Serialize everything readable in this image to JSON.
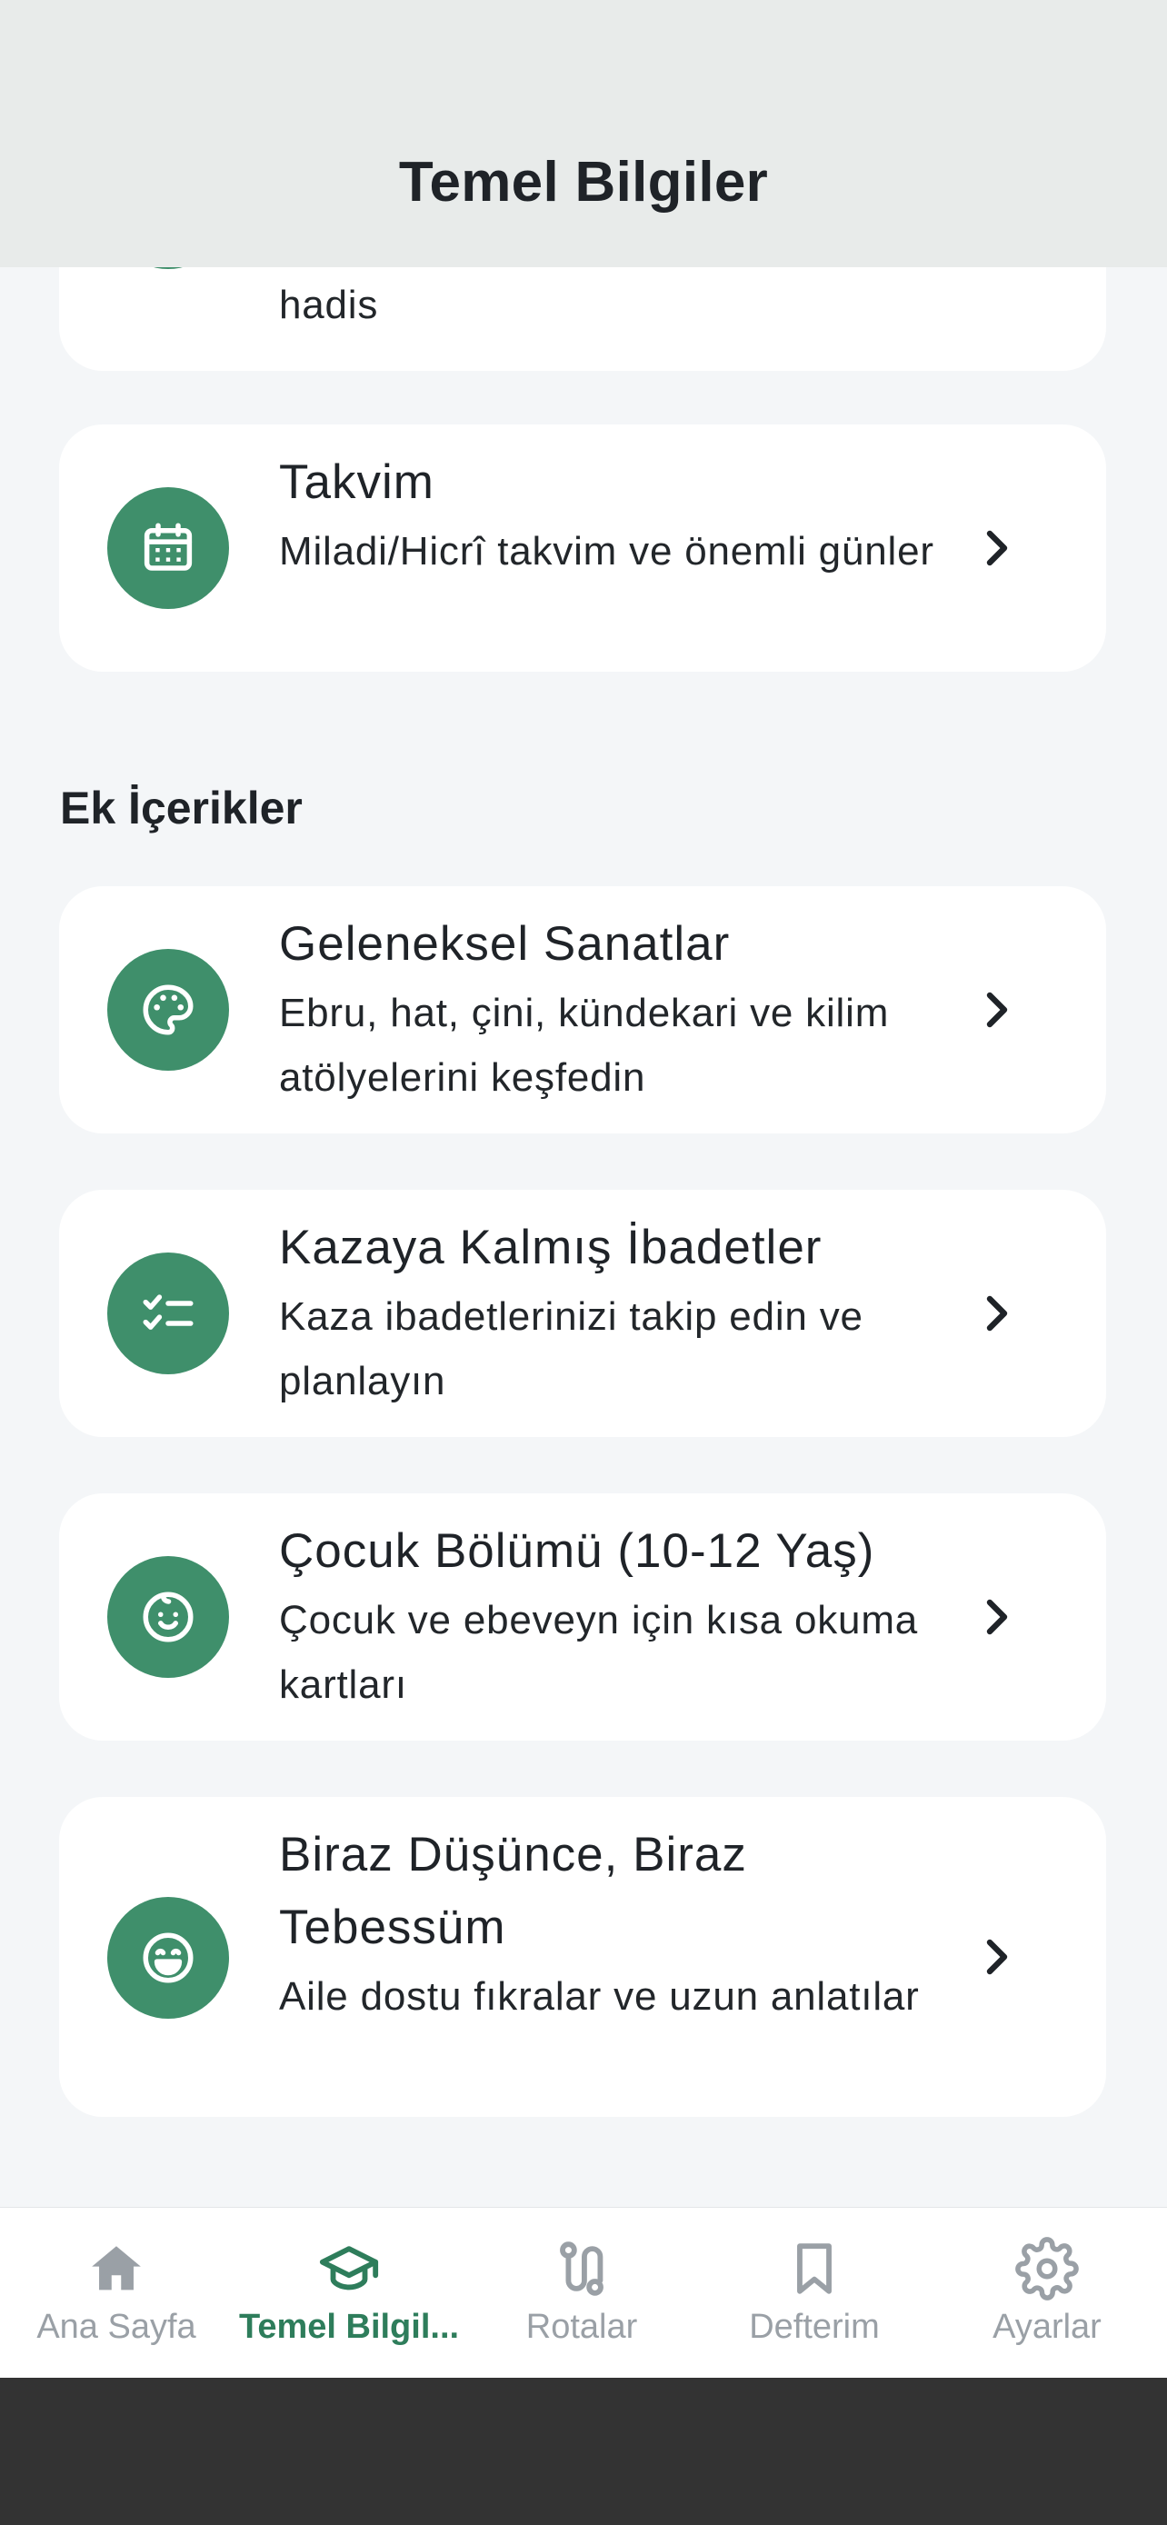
{
  "header": {
    "title": "Temel Bilgiler"
  },
  "partial_card": {
    "subtitle_tail": "hadis"
  },
  "cards_top": [
    {
      "title": "Takvim",
      "subtitle": "Miladi/Hicrî takvim ve önemli günler",
      "icon": "calendar-icon"
    }
  ],
  "section": {
    "title": "Ek İçerikler"
  },
  "cards": [
    {
      "title": "Geleneksel Sanatlar",
      "subtitle": "Ebru, hat, çini, kündekari ve kilim atölyelerini keşfedin",
      "icon": "palette-icon"
    },
    {
      "title": "Kazaya Kalmış İbadetler",
      "subtitle": "Kaza ibadetlerinizi takip edin ve planlayın",
      "icon": "checklist-icon"
    },
    {
      "title": "Çocuk Bölümü (10-12 Yaş)",
      "subtitle": "Çocuk ve ebeveyn için kısa okuma kartları",
      "icon": "child-face-icon"
    },
    {
      "title": "Biraz Düşünce, Biraz Tebessüm",
      "subtitle": "Aile dostu fıkralar ve uzun anlatılar",
      "icon": "smile-icon"
    }
  ],
  "tabbar": {
    "tabs": [
      {
        "label": "Ana Sayfa",
        "icon": "home-icon",
        "active": false
      },
      {
        "label": "Temel Bilgil...",
        "icon": "graduation-cap-icon",
        "active": true
      },
      {
        "label": "Rotalar",
        "icon": "route-icon",
        "active": false
      },
      {
        "label": "Defterim",
        "icon": "bookmark-icon",
        "active": false
      },
      {
        "label": "Ayarlar",
        "icon": "gear-icon",
        "active": false
      }
    ]
  },
  "colors": {
    "accent": "#3f8f6b",
    "active_tab": "#2e7d5b",
    "inactive_tab": "#9aa0a6",
    "header_bg": "#e8ebea",
    "page_bg": "#f4f6f8"
  }
}
